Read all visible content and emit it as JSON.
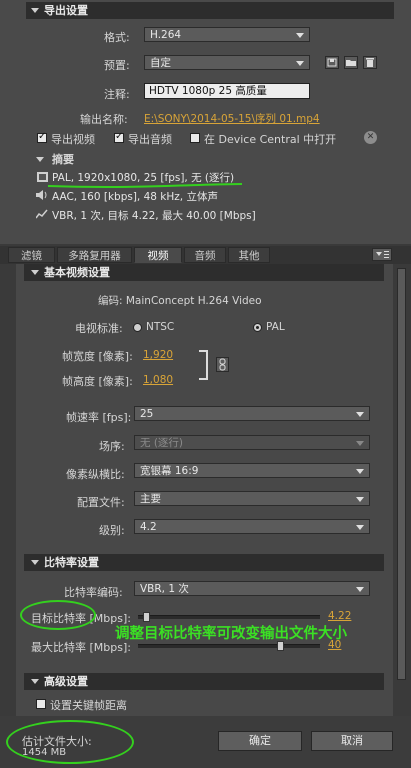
{
  "export_settings": {
    "header": "导出设置",
    "format_label": "格式:",
    "format_value": "H.264",
    "preset_label": "预置:",
    "preset_value": "自定",
    "comment_label": "注释:",
    "comment_value": "HDTV 1080p 25 高质量",
    "output_name_label": "输出名称:",
    "output_name_value": "E:\\SONY\\2014-05-15\\序列 01.mp4",
    "export_video_label": "导出视频",
    "export_audio_label": "导出音频",
    "device_central_label": "在 Device Central 中打开"
  },
  "summary": {
    "header": "摘要",
    "video_line": "PAL, 1920x1080, 25 [fps], 无 (逐行)",
    "audio_line": "AAC, 160 [kbps], 48 kHz, 立体声",
    "bitrate_line": "VBR, 1 次, 目标 4.22, 最大 40.00 [Mbps]"
  },
  "tabs": [
    "滤镜",
    "多路复用器",
    "视频",
    "音频",
    "其他"
  ],
  "basic_video": {
    "header": "基本视频设置",
    "codec_line": "编码: MainConcept H.264 Video",
    "tv_standard_label": "电视标准:",
    "ntsc_label": "NTSC",
    "pal_label": "PAL",
    "width_label": "帧宽度 [像素]:",
    "width_value": "1,920",
    "height_label": "帧高度 [像素]:",
    "height_value": "1,080",
    "framerate_label": "帧速率 [fps]:",
    "framerate_value": "25",
    "field_order_label": "场序:",
    "field_order_value": "无 (逐行)",
    "aspect_label": "像素纵横比:",
    "aspect_value": "宽银幕 16:9",
    "profile_label": "配置文件:",
    "profile_value": "主要",
    "level_label": "级别:",
    "level_value": "4.2"
  },
  "bitrate": {
    "header": "比特率设置",
    "encoding_label": "比特率编码:",
    "encoding_value": "VBR, 1 次",
    "target_label": "目标比特率 [Mbps]:",
    "target_value": "4.22",
    "target_fraction": 0.045,
    "max_label": "最大比特率 [Mbps]:",
    "max_value": "40",
    "max_fraction": 0.78
  },
  "advanced": {
    "header": "高级设置",
    "keyframe_label": "设置关键帧距离"
  },
  "footer": {
    "estimate_label": "估计文件大小:",
    "estimate_value": "1454 MB",
    "ok_label": "确定",
    "cancel_label": "取消"
  },
  "annotation": {
    "text": "调整目标比特率可改变输出文件大小",
    "color": "#34d01e"
  }
}
